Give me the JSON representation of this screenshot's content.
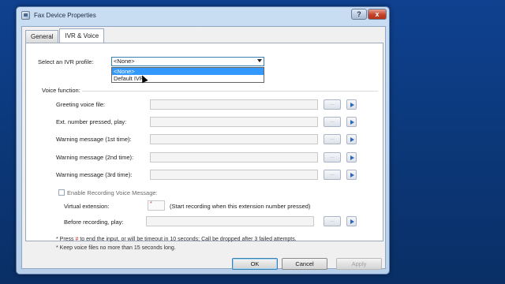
{
  "window": {
    "title": "Fax Device Properties",
    "help_label": "?",
    "close_label": "x"
  },
  "tabs": [
    {
      "label": "General",
      "active": false
    },
    {
      "label": "IVR & Voice",
      "active": true
    }
  ],
  "ivr_profile": {
    "label": "Select an IVR profile:",
    "selected": "<None>",
    "options": [
      "<None>",
      "Default IVR"
    ],
    "highlighted": "<None>"
  },
  "voice_function": {
    "label": "Voice function:",
    "rows": [
      {
        "label": "Greeting voice file:"
      },
      {
        "label": "Ext. number pressed, play:"
      },
      {
        "label": "Warning message (1st time):"
      },
      {
        "label": "Warning message (2nd time):"
      },
      {
        "label": "Warning message (3rd time):"
      }
    ],
    "browse_label": "...",
    "enable_recording": {
      "label": "Enable Recording Voice Message:",
      "checked": false
    },
    "virtual_extension": {
      "label": "Virtual extension:",
      "value": "*",
      "hint": "(Start recording when this extension number pressed)"
    },
    "before_recording": {
      "label": "Before recording, play:"
    }
  },
  "footnotes": {
    "line1_prefix": "* Press ",
    "line1_key": "#",
    "line1_suffix": " to end the input, or will be timeout in 10 seconds; Call be dropped after 3 failed attempts.",
    "line2": "* Keep voice files no more than 15 seconds long."
  },
  "buttons": {
    "ok": "OK",
    "cancel": "Cancel",
    "apply": "Apply"
  }
}
